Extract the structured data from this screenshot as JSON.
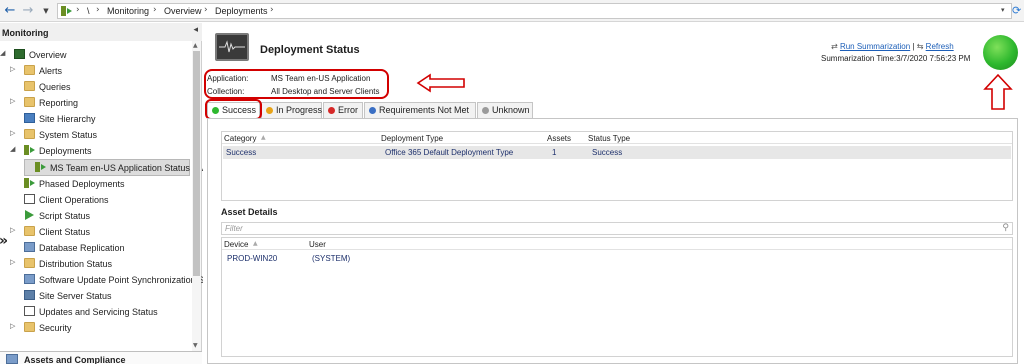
{
  "breadcrumb": {
    "root": "\\",
    "items": [
      "Monitoring",
      "Overview",
      "Deployments"
    ]
  },
  "nav": {
    "header": "Monitoring",
    "items": [
      {
        "label": "Overview",
        "icon": "overview-icon"
      },
      {
        "label": "Alerts",
        "icon": "folder-icon"
      },
      {
        "label": "Queries",
        "icon": "folder-icon"
      },
      {
        "label": "Reporting",
        "icon": "folder-icon"
      },
      {
        "label": "Site Hierarchy",
        "icon": "site-hierarchy-icon"
      },
      {
        "label": "System Status",
        "icon": "folder-icon"
      },
      {
        "label": "Deployments",
        "icon": "deployments-icon"
      },
      {
        "label": "MS Team en-US Application Status to All",
        "icon": "deployment-status-icon"
      },
      {
        "label": "Phased Deployments",
        "icon": "phased-deployments-icon"
      },
      {
        "label": "Client Operations",
        "icon": "client-operations-icon"
      },
      {
        "label": "Script Status",
        "icon": "script-status-icon"
      },
      {
        "label": "Client Status",
        "icon": "folder-icon"
      },
      {
        "label": "Database Replication",
        "icon": "database-replication-icon"
      },
      {
        "label": "Distribution Status",
        "icon": "folder-icon"
      },
      {
        "label": "Software Update Point Synchronization Sta",
        "icon": "sup-sync-icon"
      },
      {
        "label": "Site Server Status",
        "icon": "site-server-icon"
      },
      {
        "label": "Updates and Servicing Status",
        "icon": "updates-servicing-icon"
      },
      {
        "label": "Security",
        "icon": "folder-icon"
      }
    ],
    "workspace": "Assets and Compliance"
  },
  "main": {
    "title": "Deployment Status",
    "application_label": "Application:",
    "application_value": "MS Team en-US Application",
    "collection_label": "Collection:",
    "collection_value": "All Desktop and Server Clients",
    "run_summarization": "Run Summarization",
    "link_sep": "|",
    "refresh": "Refresh",
    "summarization_time": "Summarization Time:3/7/2020 7:56:23 PM",
    "tabs": [
      {
        "label": "Success",
        "color": "#2eb82e"
      },
      {
        "label": "In Progress",
        "color": "#e8a317"
      },
      {
        "label": "Error",
        "color": "#d62828"
      },
      {
        "label": "Requirements Not Met",
        "color": "#3a6fc4"
      },
      {
        "label": "Unknown",
        "color": "#9a9a9a"
      }
    ],
    "summary_grid": {
      "headers": [
        "Category",
        "Deployment Type",
        "Assets",
        "Status Type"
      ],
      "rows": [
        [
          "Success",
          "Office 365 Default Deployment Type",
          "1",
          "Success"
        ]
      ]
    },
    "asset_details_title": "Asset Details",
    "filter_placeholder": "Filter",
    "asset_grid": {
      "headers": [
        "Device",
        "User"
      ],
      "rows": [
        [
          "PROD-WIN20",
          "(SYSTEM)"
        ]
      ]
    }
  },
  "colors": {
    "annotation": "#d20000",
    "link": "#1d5fb8",
    "status_ok": "#2eb82e"
  }
}
